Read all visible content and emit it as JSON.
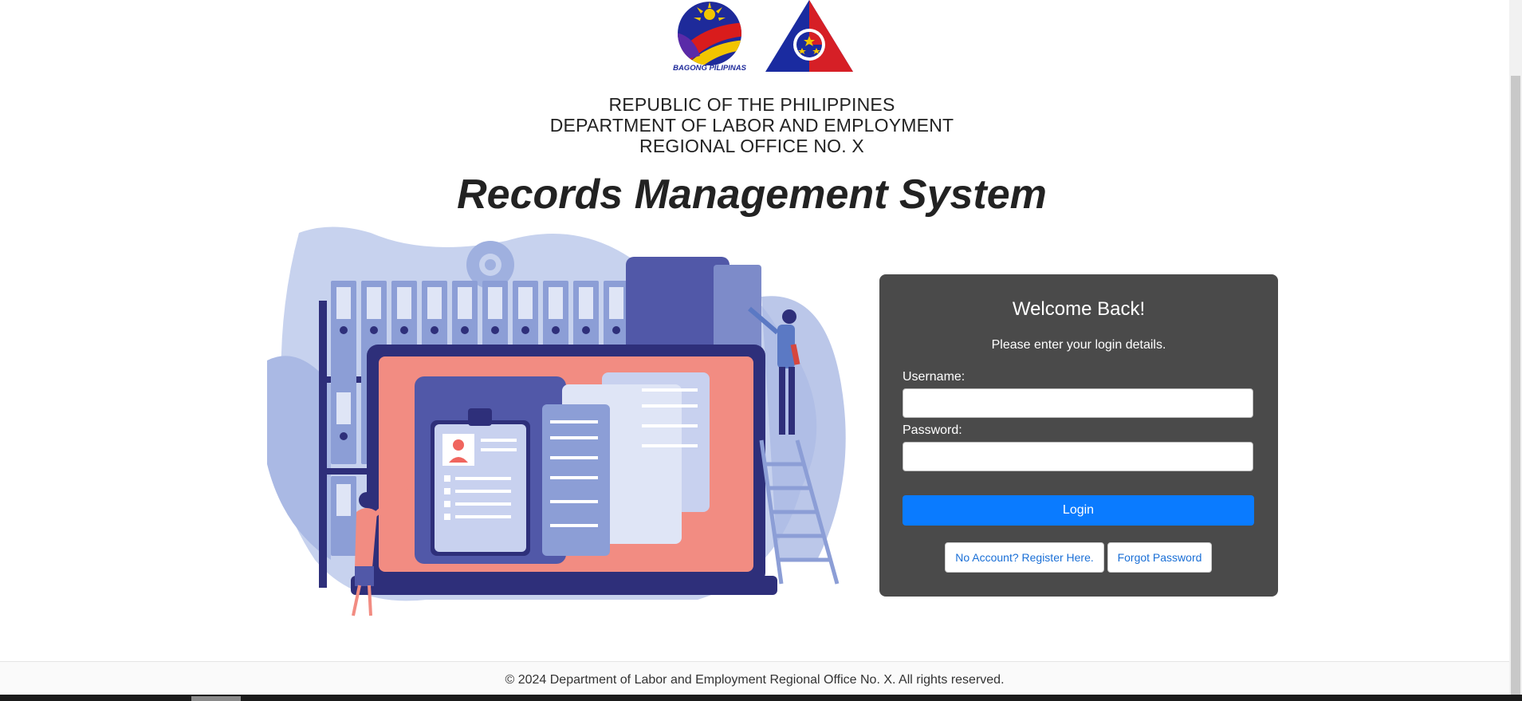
{
  "header": {
    "logo_left_text": "BAGONG PILIPINAS",
    "line1": "REPUBLIC OF THE PHILIPPINES",
    "line2": "DEPARTMENT OF LABOR AND EMPLOYMENT",
    "line3": "REGIONAL OFFICE NO. X"
  },
  "system_title": "Records Management System",
  "login": {
    "welcome": "Welcome Back!",
    "subtitle": "Please enter your login details.",
    "username_label": "Username:",
    "username_value": "",
    "password_label": "Password:",
    "password_value": "",
    "login_button": "Login",
    "register_link": "No Account? Register Here.",
    "forgot_link": "Forgot Password"
  },
  "footer": {
    "text": "© 2024 Department of Labor and Employment Regional Office No. X. All rights reserved."
  },
  "colors": {
    "card_bg": "#4a4a4a",
    "primary_button": "#0a7bff",
    "link_text": "#1a6fd6"
  },
  "icons": {
    "left_logo": "bagong-pilipinas-logo",
    "right_logo": "dole-logo",
    "illustration": "records-management-illustration"
  }
}
